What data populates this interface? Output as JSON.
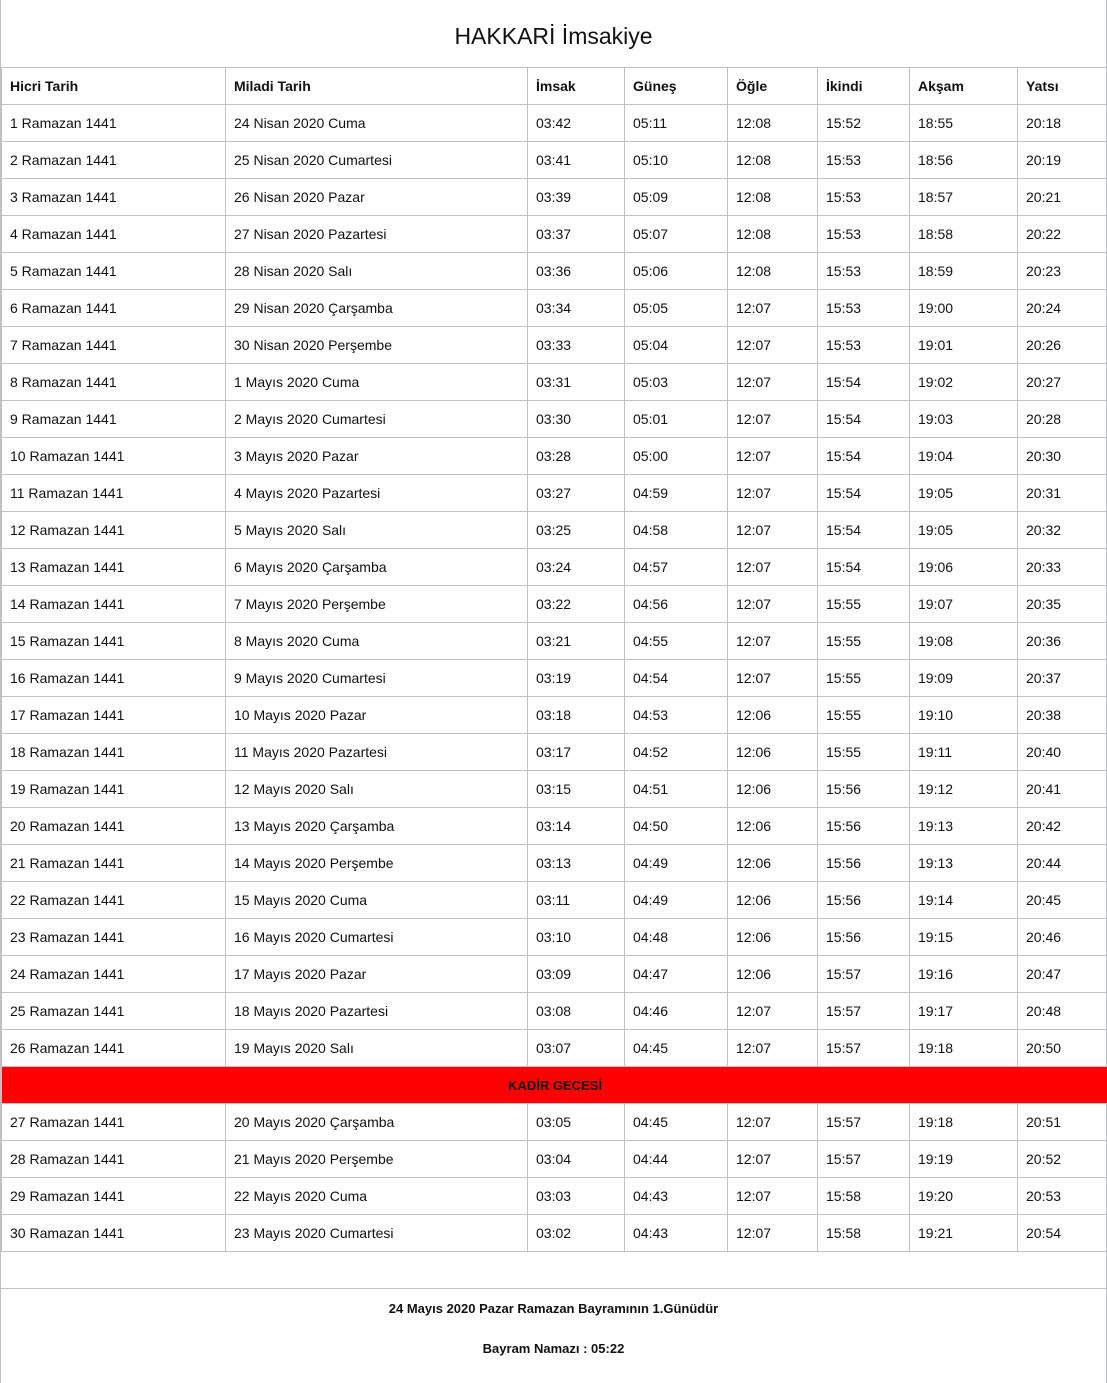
{
  "title": "HAKKARİ İmsakiye",
  "columns": [
    "Hicri Tarih",
    "Miladi Tarih",
    "İmsak",
    "Güneş",
    "Öğle",
    "İkindi",
    "Akşam",
    "Yatsı"
  ],
  "rows_part1": [
    [
      "1 Ramazan 1441",
      "24 Nisan 2020 Cuma",
      "03:42",
      "05:11",
      "12:08",
      "15:52",
      "18:55",
      "20:18"
    ],
    [
      "2 Ramazan 1441",
      "25 Nisan 2020 Cumartesi",
      "03:41",
      "05:10",
      "12:08",
      "15:53",
      "18:56",
      "20:19"
    ],
    [
      "3 Ramazan 1441",
      "26 Nisan 2020 Pazar",
      "03:39",
      "05:09",
      "12:08",
      "15:53",
      "18:57",
      "20:21"
    ],
    [
      "4 Ramazan 1441",
      "27 Nisan 2020 Pazartesi",
      "03:37",
      "05:07",
      "12:08",
      "15:53",
      "18:58",
      "20:22"
    ],
    [
      "5 Ramazan 1441",
      "28 Nisan 2020 Salı",
      "03:36",
      "05:06",
      "12:08",
      "15:53",
      "18:59",
      "20:23"
    ],
    [
      "6 Ramazan 1441",
      "29 Nisan 2020 Çarşamba",
      "03:34",
      "05:05",
      "12:07",
      "15:53",
      "19:00",
      "20:24"
    ],
    [
      "7 Ramazan 1441",
      "30 Nisan 2020 Perşembe",
      "03:33",
      "05:04",
      "12:07",
      "15:53",
      "19:01",
      "20:26"
    ],
    [
      "8 Ramazan 1441",
      "1 Mayıs 2020 Cuma",
      "03:31",
      "05:03",
      "12:07",
      "15:54",
      "19:02",
      "20:27"
    ],
    [
      "9 Ramazan 1441",
      "2 Mayıs 2020 Cumartesi",
      "03:30",
      "05:01",
      "12:07",
      "15:54",
      "19:03",
      "20:28"
    ],
    [
      "10 Ramazan 1441",
      "3 Mayıs 2020 Pazar",
      "03:28",
      "05:00",
      "12:07",
      "15:54",
      "19:04",
      "20:30"
    ],
    [
      "11 Ramazan 1441",
      "4 Mayıs 2020 Pazartesi",
      "03:27",
      "04:59",
      "12:07",
      "15:54",
      "19:05",
      "20:31"
    ],
    [
      "12 Ramazan 1441",
      "5 Mayıs 2020 Salı",
      "03:25",
      "04:58",
      "12:07",
      "15:54",
      "19:05",
      "20:32"
    ],
    [
      "13 Ramazan 1441",
      "6 Mayıs 2020 Çarşamba",
      "03:24",
      "04:57",
      "12:07",
      "15:54",
      "19:06",
      "20:33"
    ],
    [
      "14 Ramazan 1441",
      "7 Mayıs 2020 Perşembe",
      "03:22",
      "04:56",
      "12:07",
      "15:55",
      "19:07",
      "20:35"
    ],
    [
      "15 Ramazan 1441",
      "8 Mayıs 2020 Cuma",
      "03:21",
      "04:55",
      "12:07",
      "15:55",
      "19:08",
      "20:36"
    ],
    [
      "16 Ramazan 1441",
      "9 Mayıs 2020 Cumartesi",
      "03:19",
      "04:54",
      "12:07",
      "15:55",
      "19:09",
      "20:37"
    ],
    [
      "17 Ramazan 1441",
      "10 Mayıs 2020 Pazar",
      "03:18",
      "04:53",
      "12:06",
      "15:55",
      "19:10",
      "20:38"
    ],
    [
      "18 Ramazan 1441",
      "11 Mayıs 2020 Pazartesi",
      "03:17",
      "04:52",
      "12:06",
      "15:55",
      "19:11",
      "20:40"
    ],
    [
      "19 Ramazan 1441",
      "12 Mayıs 2020 Salı",
      "03:15",
      "04:51",
      "12:06",
      "15:56",
      "19:12",
      "20:41"
    ],
    [
      "20 Ramazan 1441",
      "13 Mayıs 2020 Çarşamba",
      "03:14",
      "04:50",
      "12:06",
      "15:56",
      "19:13",
      "20:42"
    ],
    [
      "21 Ramazan 1441",
      "14 Mayıs 2020 Perşembe",
      "03:13",
      "04:49",
      "12:06",
      "15:56",
      "19:13",
      "20:44"
    ],
    [
      "22 Ramazan 1441",
      "15 Mayıs 2020 Cuma",
      "03:11",
      "04:49",
      "12:06",
      "15:56",
      "19:14",
      "20:45"
    ],
    [
      "23 Ramazan 1441",
      "16 Mayıs 2020 Cumartesi",
      "03:10",
      "04:48",
      "12:06",
      "15:56",
      "19:15",
      "20:46"
    ],
    [
      "24 Ramazan 1441",
      "17 Mayıs 2020 Pazar",
      "03:09",
      "04:47",
      "12:06",
      "15:57",
      "19:16",
      "20:47"
    ],
    [
      "25 Ramazan 1441",
      "18 Mayıs 2020 Pazartesi",
      "03:08",
      "04:46",
      "12:07",
      "15:57",
      "19:17",
      "20:48"
    ],
    [
      "26 Ramazan 1441",
      "19 Mayıs 2020 Salı",
      "03:07",
      "04:45",
      "12:07",
      "15:57",
      "19:18",
      "20:50"
    ]
  ],
  "kadir_label": "KADİR GECESİ",
  "rows_part2": [
    [
      "27 Ramazan 1441",
      "20 Mayıs 2020 Çarşamba",
      "03:05",
      "04:45",
      "12:07",
      "15:57",
      "19:18",
      "20:51"
    ],
    [
      "28 Ramazan 1441",
      "21 Mayıs 2020 Perşembe",
      "03:04",
      "04:44",
      "12:07",
      "15:57",
      "19:19",
      "20:52"
    ],
    [
      "29 Ramazan 1441",
      "22 Mayıs 2020 Cuma",
      "03:03",
      "04:43",
      "12:07",
      "15:58",
      "19:20",
      "20:53"
    ],
    [
      "30 Ramazan 1441",
      "23 Mayıs 2020 Cumartesi",
      "03:02",
      "04:43",
      "12:07",
      "15:58",
      "19:21",
      "20:54"
    ]
  ],
  "footer": {
    "bayram_line": "24 Mayıs 2020 Pazar Ramazan Bayramının 1.Günüdür",
    "namaz_line": "Bayram Namazı : 05:22"
  },
  "colors": {
    "kadir_bg": "#ff0000",
    "grid": "#bcc2c6"
  }
}
